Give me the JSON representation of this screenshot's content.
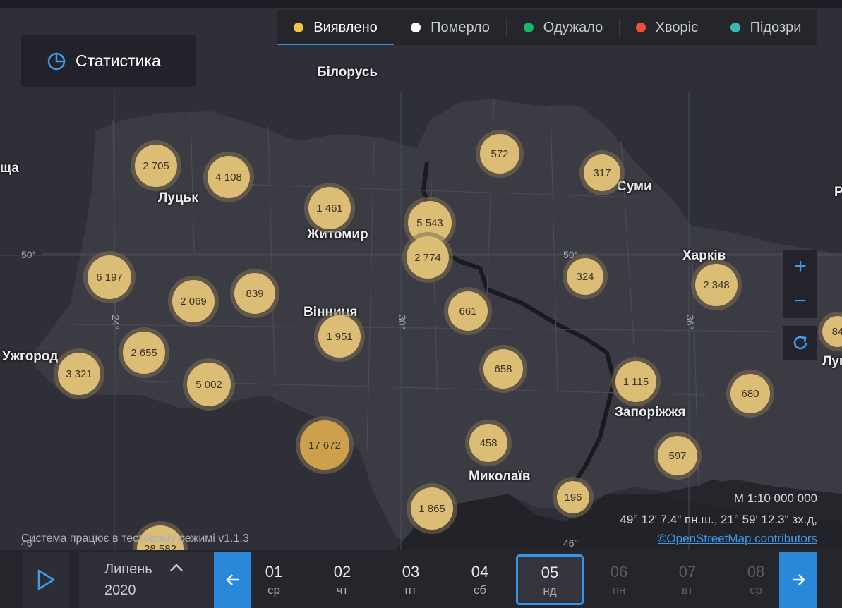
{
  "tabs": [
    {
      "label": "Виявлено",
      "color": "#f4c542",
      "active": true
    },
    {
      "label": "Померло",
      "color": "#ffffff",
      "active": false
    },
    {
      "label": "Одужало",
      "color": "#1eb56a",
      "active": false
    },
    {
      "label": "Хворіє",
      "color": "#e8553a",
      "active": false
    },
    {
      "label": "Підозри",
      "color": "#38b8b0",
      "active": false
    }
  ],
  "stat_button": {
    "label": "Статистика"
  },
  "clusters": [
    {
      "value": "2 705"
    },
    {
      "value": "4 108"
    },
    {
      "value": "1 461"
    },
    {
      "value": "5 543"
    },
    {
      "value": "572"
    },
    {
      "value": "317"
    },
    {
      "value": "2 774"
    },
    {
      "value": "6 197"
    },
    {
      "value": "2 069"
    },
    {
      "value": "839"
    },
    {
      "value": "324"
    },
    {
      "value": "2 348"
    },
    {
      "value": "661"
    },
    {
      "value": "1 951"
    },
    {
      "value": "2 655"
    },
    {
      "value": "3 321"
    },
    {
      "value": "5 002"
    },
    {
      "value": "658"
    },
    {
      "value": "1 115"
    },
    {
      "value": "680"
    },
    {
      "value": "17 672"
    },
    {
      "value": "458"
    },
    {
      "value": "597"
    },
    {
      "value": "1 865"
    },
    {
      "value": "196"
    },
    {
      "value": "28 582"
    },
    {
      "value": "84"
    }
  ],
  "cities": [
    {
      "name": "Білорусь"
    },
    {
      "name": "Луцьк"
    },
    {
      "name": "Житомир"
    },
    {
      "name": "Суми"
    },
    {
      "name": "Харків"
    },
    {
      "name": "Вінниця"
    },
    {
      "name": "Ужгород"
    },
    {
      "name": "Запоріжжя"
    },
    {
      "name": "Миколаїв"
    },
    {
      "name": "Луг"
    },
    {
      "name": "ща"
    },
    {
      "name": "Р"
    }
  ],
  "graticule": {
    "lat50": "50°",
    "lat50b": "50°",
    "lat46": "46°",
    "lat46b": "46°",
    "lon24": "24°",
    "lon30": "30°",
    "lon36": "36°"
  },
  "scale": "М 1:10 000 000",
  "coords": "49° 12' 7.4\" пн.ш., 21° 59' 12.3\" зх.д,",
  "attribution": "©OpenStreetMap contributors",
  "system_message": "Система працює в тестовому режимі v1.1.3",
  "zoom": {
    "in": "+",
    "out": "−"
  },
  "timeline": {
    "month": "Липень",
    "year": "2020",
    "days": [
      {
        "num": "01",
        "wd": "ср",
        "state": "normal"
      },
      {
        "num": "02",
        "wd": "чт",
        "state": "normal"
      },
      {
        "num": "03",
        "wd": "пт",
        "state": "normal"
      },
      {
        "num": "04",
        "wd": "сб",
        "state": "normal"
      },
      {
        "num": "05",
        "wd": "нд",
        "state": "selected"
      },
      {
        "num": "06",
        "wd": "пн",
        "state": "dim"
      },
      {
        "num": "07",
        "wd": "вт",
        "state": "dim"
      },
      {
        "num": "08",
        "wd": "ср",
        "state": "dim"
      }
    ]
  }
}
